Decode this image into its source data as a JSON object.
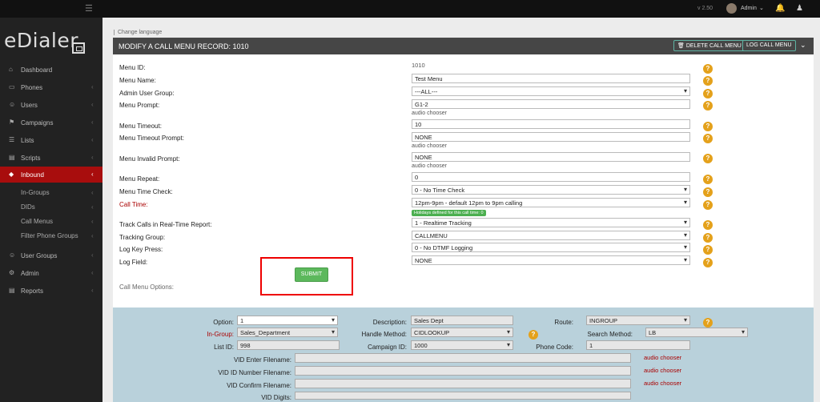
{
  "topbar": {
    "version": "v 2.50",
    "user": "Admin"
  },
  "sidebar": {
    "logo": "eDialer",
    "items": [
      {
        "label": "Dashboard"
      },
      {
        "label": "Phones"
      },
      {
        "label": "Users"
      },
      {
        "label": "Campaigns"
      },
      {
        "label": "Lists"
      },
      {
        "label": "Scripts"
      },
      {
        "label": "Inbound"
      }
    ],
    "subitems": [
      {
        "label": "In-Groups"
      },
      {
        "label": "DIDs"
      },
      {
        "label": "Call Menus"
      },
      {
        "label": "Filter Phone Groups"
      }
    ],
    "items2": [
      {
        "label": "User Groups"
      },
      {
        "label": "Admin"
      },
      {
        "label": "Reports"
      }
    ]
  },
  "change_language": "Change language",
  "panel": {
    "title": "MODIFY A CALL MENU RECORD: 1010",
    "delete_label": "DELETE CALL MENU",
    "log_label": "LOG CALL MENU"
  },
  "form": {
    "menu_id": {
      "label": "Menu ID:",
      "value": "1010"
    },
    "menu_name": {
      "label": "Menu Name:",
      "value": "Test Menu"
    },
    "admin_group": {
      "label": "Admin User Group:",
      "value": "---ALL---"
    },
    "menu_prompt": {
      "label": "Menu Prompt:",
      "value": "G1-2",
      "chooser": "audio chooser"
    },
    "menu_timeout": {
      "label": "Menu Timeout:",
      "value": "10"
    },
    "timeout_prompt": {
      "label": "Menu Timeout Prompt:",
      "value": "NONE",
      "chooser": "audio chooser"
    },
    "invalid_prompt": {
      "label": "Menu Invalid Prompt:",
      "value": "NONE",
      "chooser": "audio chooser"
    },
    "menu_repeat": {
      "label": "Menu Repeat:",
      "value": "0"
    },
    "time_check": {
      "label": "Menu Time Check:",
      "value": "0 - No Time Check"
    },
    "call_time": {
      "label": "Call Time:",
      "value": "12pm-9pm - default 12pm to 9pm calling",
      "holiday": "Holidays defined for this call time: 0"
    },
    "track_calls": {
      "label": "Track Calls in Real-Time Report:",
      "value": "1 - Realtime Tracking"
    },
    "tracking_group": {
      "label": "Tracking Group:",
      "value": "CALLMENU"
    },
    "log_key": {
      "label": "Log Key Press:",
      "value": "0 - No DTMF Logging"
    },
    "log_field": {
      "label": "Log Field:",
      "value": "NONE"
    },
    "submit": "SUBMIT",
    "options_title": "Call Menu Options:"
  },
  "options": {
    "option": {
      "label": "Option:",
      "value": "1"
    },
    "description": {
      "label": "Description:",
      "value": "Sales Dept"
    },
    "route": {
      "label": "Route:",
      "value": "INGROUP"
    },
    "in_group": {
      "label": "In-Group:",
      "value": "Sales_Department"
    },
    "handle_method": {
      "label": "Handle Method:",
      "value": "CIDLOOKUP"
    },
    "search_method": {
      "label": "Search Method:",
      "value": "LB"
    },
    "list_id": {
      "label": "List ID:",
      "value": "998"
    },
    "campaign_id": {
      "label": "Campaign ID:",
      "value": "1000"
    },
    "phone_code": {
      "label": "Phone Code:",
      "value": "1"
    },
    "vid_enter": {
      "label": "VID Enter Filename:",
      "chooser": "audio chooser"
    },
    "vid_number": {
      "label": "VID ID Number Filename:",
      "chooser": "audio chooser"
    },
    "vid_confirm": {
      "label": "VID Confirm Filename:",
      "chooser": "audio chooser"
    },
    "vid_digits": {
      "label": "VID Digits:"
    }
  },
  "colors": {
    "accent": "#a80d0d",
    "submit": "#5cb85c",
    "help": "#e4a11b",
    "options_bg": "#b9d1db"
  }
}
